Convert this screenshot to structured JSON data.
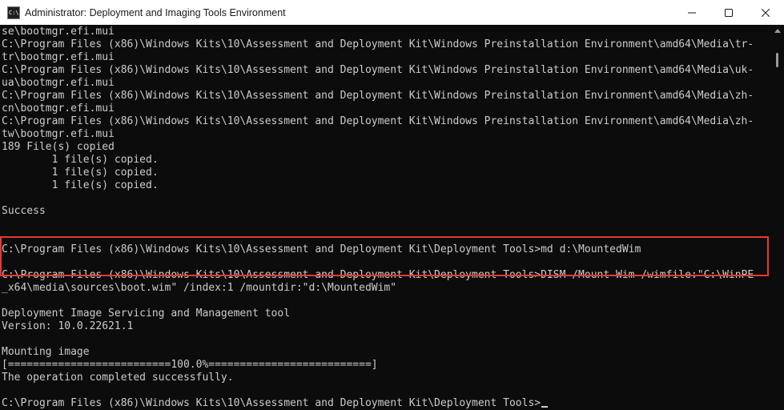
{
  "window": {
    "title": "Administrator: Deployment and Imaging Tools Environment",
    "icon_glyph": "C:\\",
    "icon": "console-icon",
    "buttons": [
      "minimize-icon",
      "maximize-icon",
      "close-icon"
    ]
  },
  "console": {
    "lines": [
      "se\\bootmgr.efi.mui",
      "C:\\Program Files (x86)\\Windows Kits\\10\\Assessment and Deployment Kit\\Windows Preinstallation Environment\\amd64\\Media\\tr-",
      "tr\\bootmgr.efi.mui",
      "C:\\Program Files (x86)\\Windows Kits\\10\\Assessment and Deployment Kit\\Windows Preinstallation Environment\\amd64\\Media\\uk-",
      "ua\\bootmgr.efi.mui",
      "C:\\Program Files (x86)\\Windows Kits\\10\\Assessment and Deployment Kit\\Windows Preinstallation Environment\\amd64\\Media\\zh-",
      "cn\\bootmgr.efi.mui",
      "C:\\Program Files (x86)\\Windows Kits\\10\\Assessment and Deployment Kit\\Windows Preinstallation Environment\\amd64\\Media\\zh-",
      "tw\\bootmgr.efi.mui",
      "189 File(s) copied",
      "        1 file(s) copied.",
      "        1 file(s) copied.",
      "        1 file(s) copied.",
      "",
      "Success",
      "",
      "",
      "C:\\Program Files (x86)\\Windows Kits\\10\\Assessment and Deployment Kit\\Deployment Tools>md d:\\MountedWim",
      "",
      "C:\\Program Files (x86)\\Windows Kits\\10\\Assessment and Deployment Kit\\Deployment Tools>DISM /Mount-Wim /wimfile:\"C:\\WinPE",
      "_x64\\media\\sources\\boot.wim\" /index:1 /mountdir:\"d:\\MountedWim\"",
      "",
      "Deployment Image Servicing and Management tool",
      "Version: 10.0.22621.1",
      "",
      "Mounting image",
      "[==========================100.0%==========================]",
      "The operation completed successfully.",
      "",
      "C:\\Program Files (x86)\\Windows Kits\\10\\Assessment and Deployment Kit\\Deployment Tools>"
    ],
    "highlight_color": "#e53935",
    "text_color": "#cccccc",
    "background": "#0c0c0c"
  }
}
